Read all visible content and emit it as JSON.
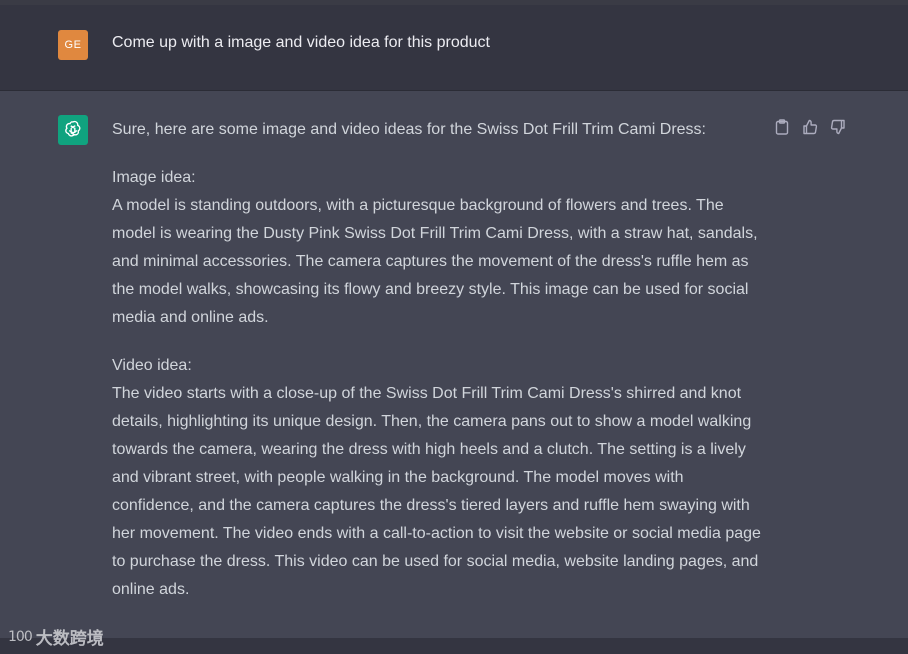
{
  "user_message": {
    "avatar_initials": "GE",
    "text": "Come up with a image and video idea for this product"
  },
  "assistant_message": {
    "intro": "Sure, here are some image and video ideas for the Swiss Dot Frill Trim Cami Dress:",
    "image_idea": {
      "heading": "Image idea:",
      "body": "A model is standing outdoors, with a picturesque background of flowers and trees. The model is wearing the Dusty Pink Swiss Dot Frill Trim Cami Dress, with a straw hat, sandals, and minimal accessories. The camera captures the movement of the dress's ruffle hem as the model walks, showcasing its flowy and breezy style. This image can be used for social media and online ads."
    },
    "video_idea": {
      "heading": "Video idea:",
      "body": "The video starts with a close-up of the Swiss Dot Frill Trim Cami Dress's shirred and knot details, highlighting its unique design. Then, the camera pans out to show a model walking towards the camera, wearing the dress with high heels and a clutch. The setting is a lively and vibrant street, with people walking in the background. The model moves with confidence, and the camera captures the dress's tiered layers and ruffle hem swaying with her movement. The video ends with a call-to-action to visit the website or social media page to purchase the dress. This video can be used for social media, website landing pages, and online ads."
    },
    "actions": [
      "clipboard-icon",
      "thumbs-up-icon",
      "thumbs-down-icon"
    ]
  },
  "watermark": {
    "logo": "100",
    "text": "大数跨境"
  },
  "colors": {
    "user_avatar": "#e0883f",
    "bot_avatar": "#10a37f",
    "user_row_bg": "#343541",
    "bot_row_bg": "#444654"
  }
}
